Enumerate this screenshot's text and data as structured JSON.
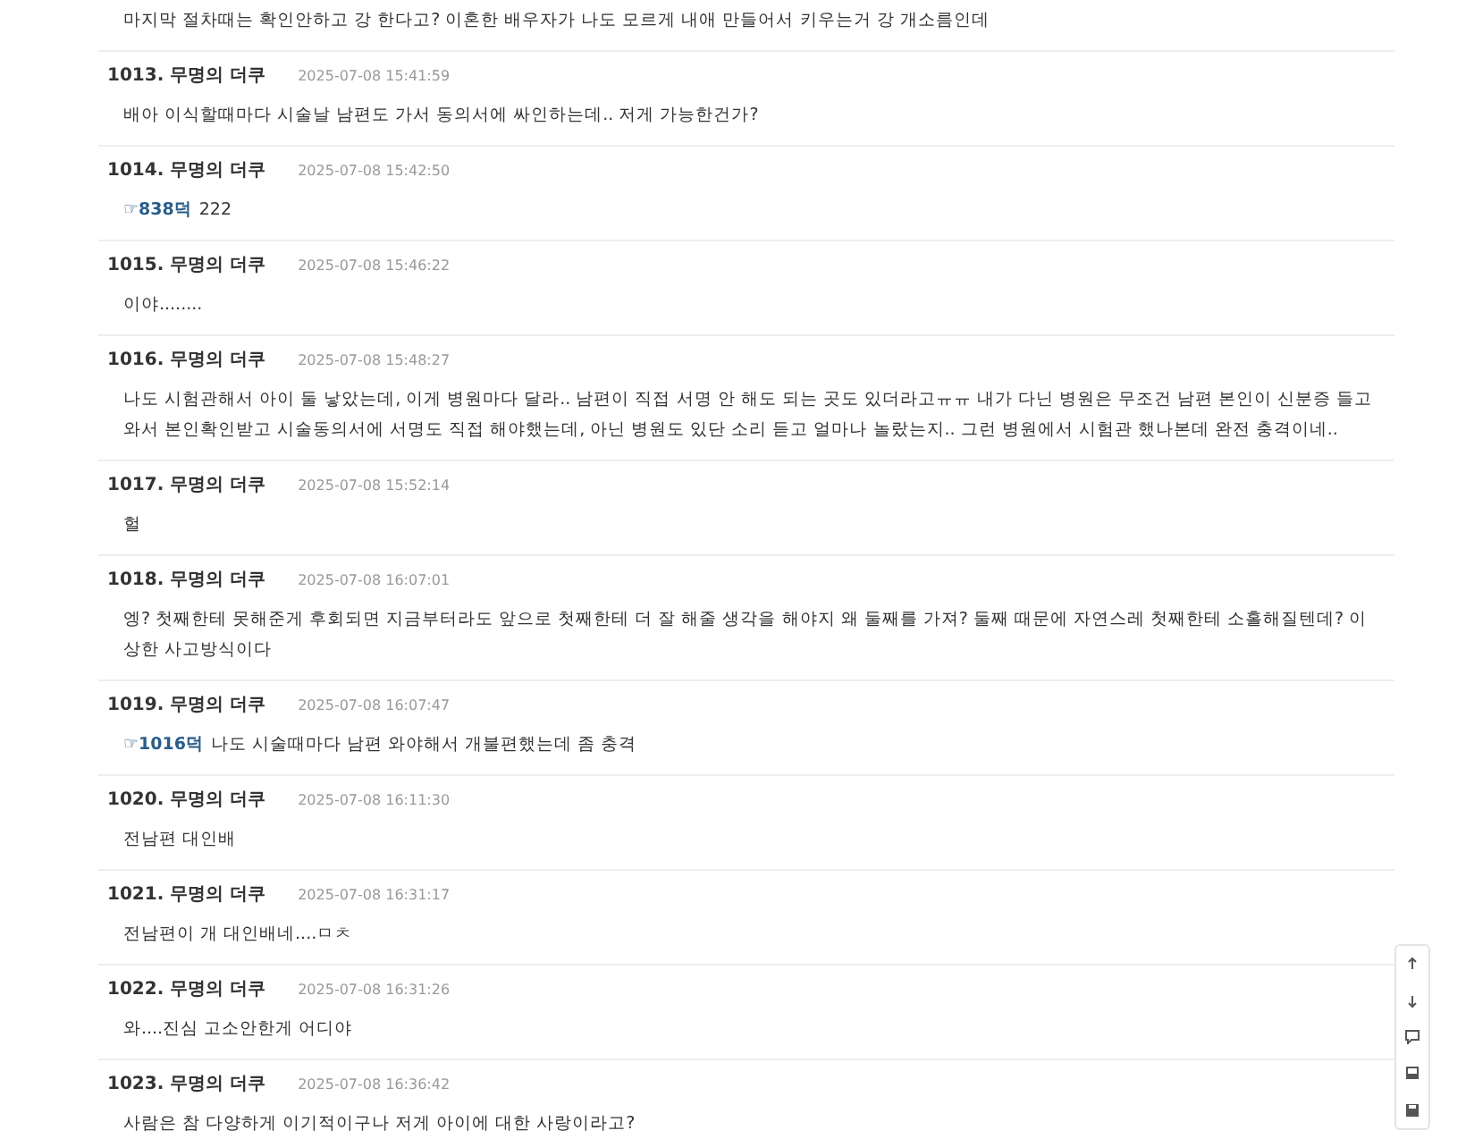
{
  "continued_text": "마지막 절차때는 확인안하고 강 한다고? 이혼한 배우자가 나도 모르게 내애 만들어서 키우는거 강 개소름인데",
  "comments": [
    {
      "number": "1013.",
      "author": "무명의 더쿠",
      "time": "2025-07-08 15:41:59",
      "text": "배아 이식할때마다 시술날 남편도 가서 동의서에 싸인하는데.. 저게 가능한건가?"
    },
    {
      "number": "1014.",
      "author": "무명의 더쿠",
      "time": "2025-07-08 15:42:50",
      "ref": "☞838덕",
      "text": "222"
    },
    {
      "number": "1015.",
      "author": "무명의 더쿠",
      "time": "2025-07-08 15:46:22",
      "text": "이야........"
    },
    {
      "number": "1016.",
      "author": "무명의 더쿠",
      "time": "2025-07-08 15:48:27",
      "text": "나도 시험관해서 아이 둘 낳았는데, 이게 병원마다 달라.. 남편이 직접 서명 안 해도 되는 곳도 있더라고ㅠㅠ 내가 다닌 병원은 무조건 남편 본인이 신분증 들고 와서 본인확인받고 시술동의서에 서명도 직접 해야했는데, 아닌 병원도 있단 소리 듣고 얼마나 놀랐는지.. 그런 병원에서 시험관 했나본데 완전 충격이네.."
    },
    {
      "number": "1017.",
      "author": "무명의 더쿠",
      "time": "2025-07-08 15:52:14",
      "text": "헐"
    },
    {
      "number": "1018.",
      "author": "무명의 더쿠",
      "time": "2025-07-08 16:07:01",
      "text": "엥? 첫째한테 못해준게 후회되면 지금부터라도 앞으로 첫째한테 더 잘 해줄 생각을 해야지 왜 둘째를 가져? 둘째 때문에 자연스레 첫째한테 소홀해질텐데? 이상한 사고방식이다"
    },
    {
      "number": "1019.",
      "author": "무명의 더쿠",
      "time": "2025-07-08 16:07:47",
      "ref": "☞1016덕",
      "text": "나도 시술때마다 남편 와야해서 개불편했는데 좀 충격"
    },
    {
      "number": "1020.",
      "author": "무명의 더쿠",
      "time": "2025-07-08 16:11:30",
      "text": "전남편 대인배"
    },
    {
      "number": "1021.",
      "author": "무명의 더쿠",
      "time": "2025-07-08 16:31:17",
      "text": "전남편이 개 대인배네....ㅁㅊ"
    },
    {
      "number": "1022.",
      "author": "무명의 더쿠",
      "time": "2025-07-08 16:31:26",
      "text": "와....진심 고소안한게 어디야"
    },
    {
      "number": "1023.",
      "author": "무명의 더쿠",
      "time": "2025-07-08 16:36:42",
      "text": "사람은 참 다양하게 이기적이구나 저게 아이에 대한 사랑이라고?"
    }
  ]
}
